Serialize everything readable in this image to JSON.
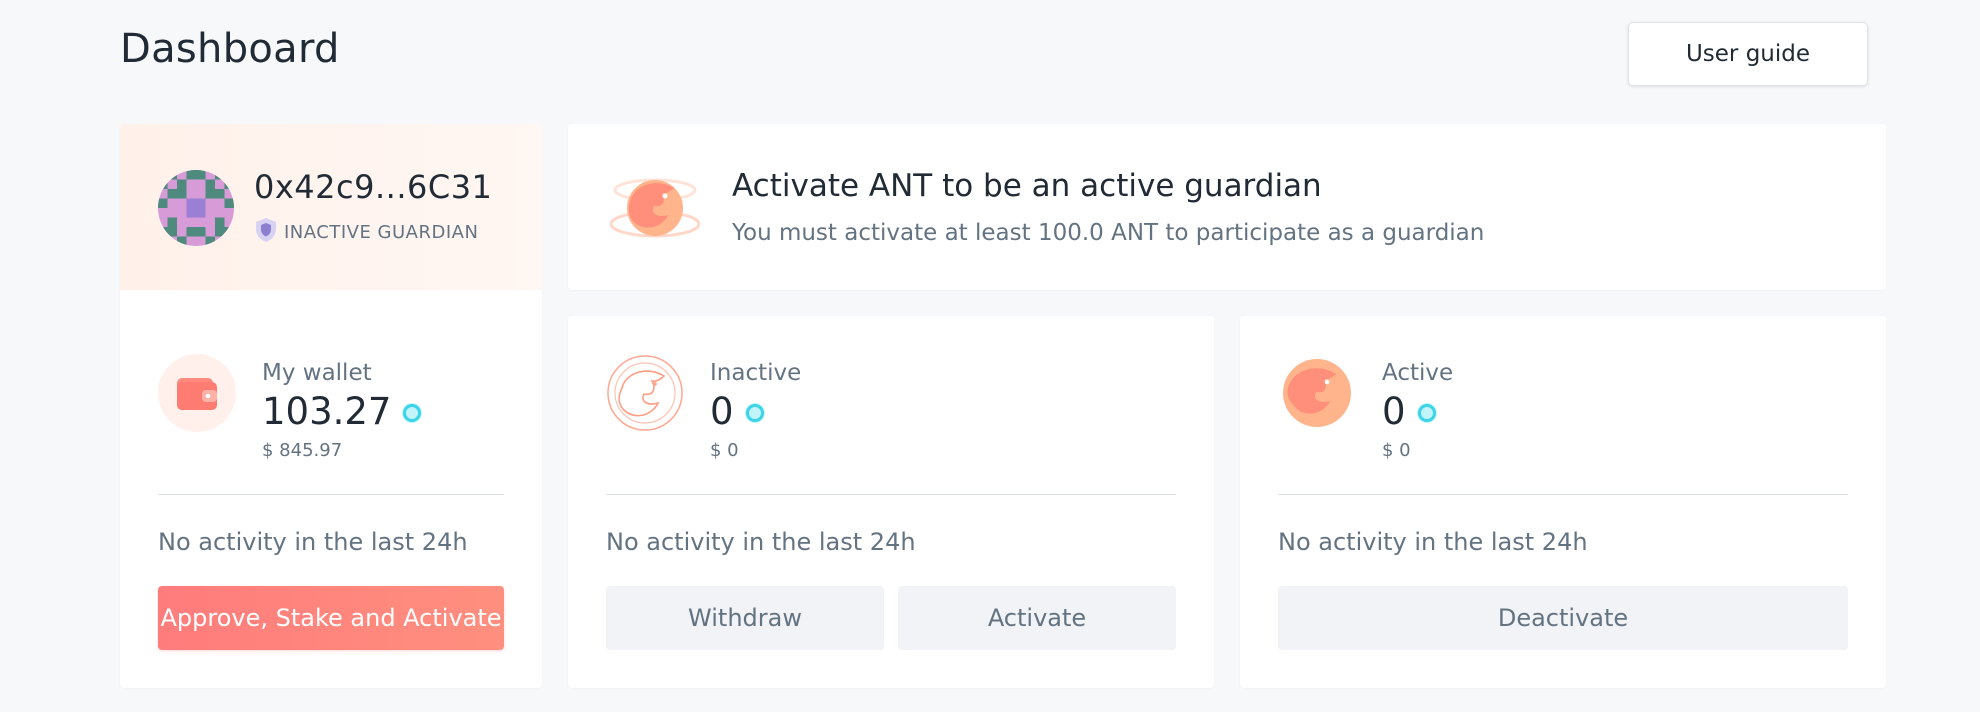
{
  "header": {
    "title": "Dashboard",
    "user_guide_label": "User guide"
  },
  "profile": {
    "address": "0x42c9...6C31",
    "status": "INACTIVE GUARDIAN",
    "wallet": {
      "label": "My wallet",
      "amount": "103.27",
      "usd": "$ 845.97",
      "activity": "No activity in the last 24h",
      "action_label": "Approve, Stake and Activate"
    }
  },
  "banner": {
    "title": "Activate ANT to be an active guardian",
    "subtitle": "You must activate at least 100.0 ANT to participate as a guardian"
  },
  "inactive": {
    "label": "Inactive",
    "amount": "0",
    "usd": "$ 0",
    "activity": "No activity in the last 24h",
    "withdraw_label": "Withdraw",
    "activate_label": "Activate"
  },
  "active": {
    "label": "Active",
    "amount": "0",
    "usd": "$ 0",
    "activity": "No activity in the last 24h",
    "deactivate_label": "Deactivate"
  },
  "colors": {
    "accent": "#ff7c7c",
    "token": "#3bd4e8",
    "muted_text": "#637381",
    "primary_text": "#212b36"
  },
  "icons": {
    "wallet": "wallet-icon",
    "token": "ant-token-icon",
    "eagle": "eagle-icon",
    "shield": "shield-icon"
  }
}
